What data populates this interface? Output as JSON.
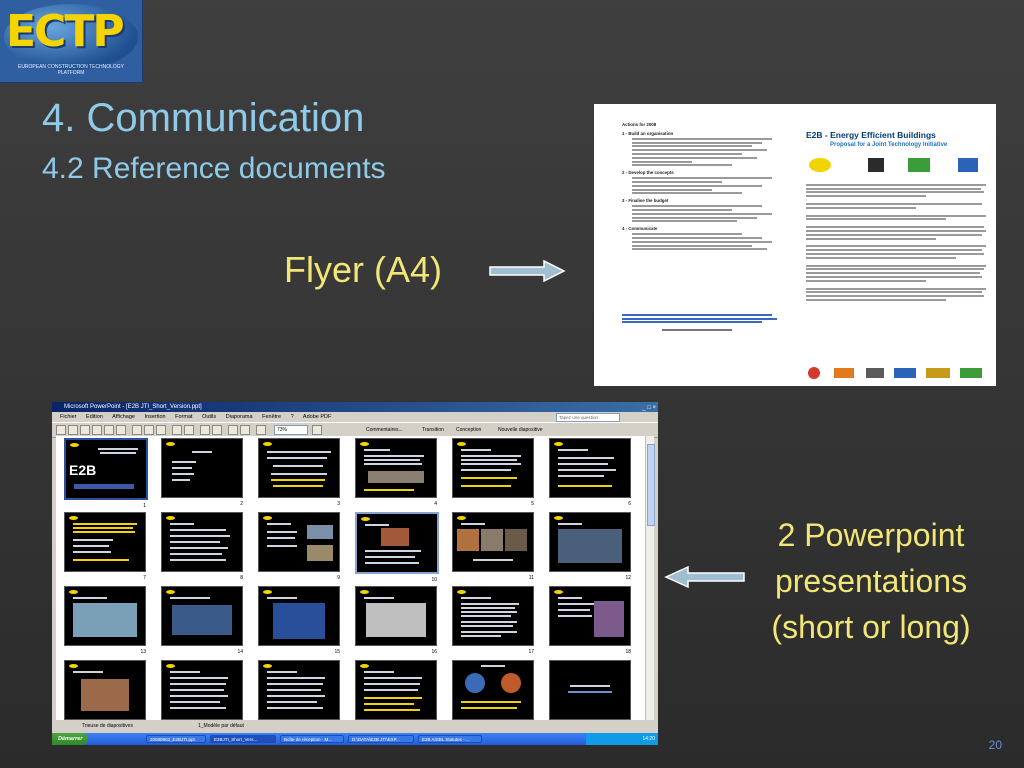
{
  "logo": {
    "letters": "ECTP",
    "tagline": "EUROPEAN CONSTRUCTION TECHNOLOGY PLATFORM"
  },
  "slide": {
    "title": "4. Communication",
    "subtitle": "4.2 Reference documents",
    "flyer_label": "Flyer (A4)",
    "ppt_label_line1": "2 Powerpoint",
    "ppt_label_line2": "presentations",
    "ppt_label_line3": "(short or long)",
    "page_number": "20"
  },
  "flyer": {
    "heading": "E2B - Energy Efficient Buildings",
    "subheading": "Proposal for a Joint Technology Initiative",
    "actions_title": "Actions for 2008",
    "sections": [
      "1 - Build an organisation",
      "2 - Develop the concepts",
      "3 - Finalise the budget",
      "4 - Communicate"
    ]
  },
  "powerpoint": {
    "window_title": "Microsoft PowerPoint - [E2B JTI_Short_Version.ppt]",
    "menu": [
      "Fichier",
      "Edition",
      "Affichage",
      "Insertion",
      "Format",
      "Outils",
      "Diaporama",
      "Fenêtre",
      "?",
      "Adobe PDF"
    ],
    "question_placeholder": "Tapez une question",
    "zoom": "73%",
    "toolbar_buttons": [
      "Commentaires...",
      "Transition",
      "Conception",
      "Nouvelle diapositive"
    ],
    "thumb_title": "E2B",
    "slide_numbers": [
      "1",
      "2",
      "3",
      "4",
      "5",
      "6",
      "7",
      "8",
      "9",
      "10",
      "11",
      "12",
      "13",
      "14",
      "15",
      "16",
      "17",
      "18"
    ],
    "status_tabs": [
      "Trieuse de diapositives",
      "1_Modèle par défaut"
    ],
    "taskbar": {
      "start": "Démarrer",
      "tasks": [
        "20080903_E2BJTI.ppt",
        "E2BJTI_Short_Vers...",
        "Boîte de réception - M...",
        "D:\\DATA\\E2B JTI\\EXP...",
        "E2B AISBL Statutes - ..."
      ],
      "time": "14:20"
    }
  }
}
